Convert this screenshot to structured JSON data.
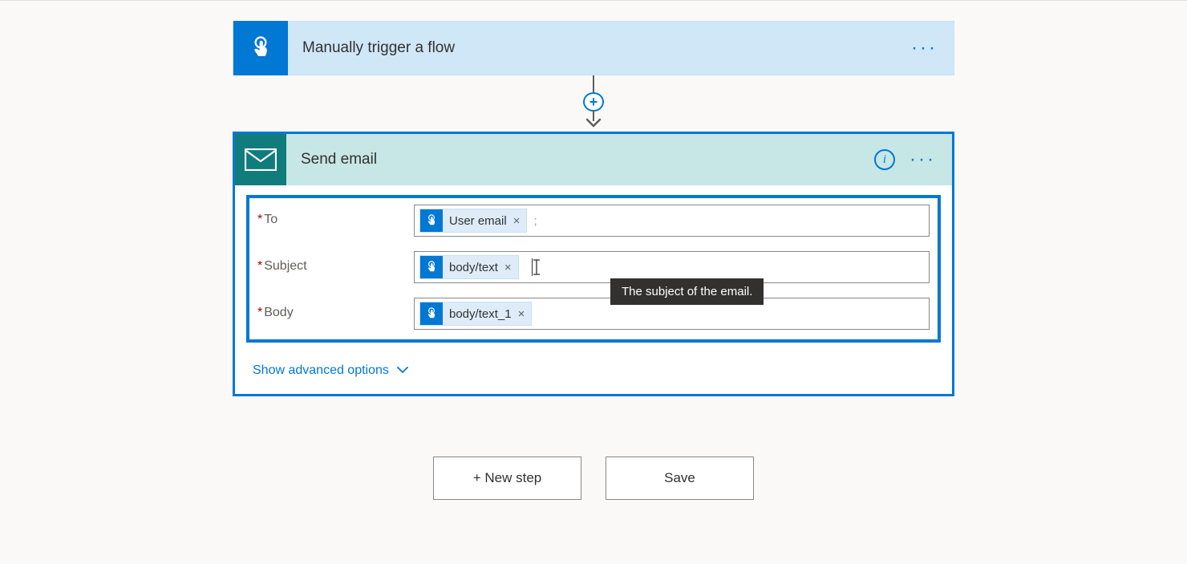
{
  "trigger": {
    "title": "Manually trigger a flow"
  },
  "action": {
    "title": "Send email",
    "tooltip": "The subject of the email.",
    "fields": {
      "to": {
        "label": "To",
        "token": "User email",
        "trailing": ";"
      },
      "subject": {
        "label": "Subject",
        "token": "body/text"
      },
      "body": {
        "label": "Body",
        "token": "body/text_1"
      }
    },
    "advanced_label": "Show advanced options"
  },
  "footer": {
    "new_step": "+ New step",
    "save": "Save"
  }
}
